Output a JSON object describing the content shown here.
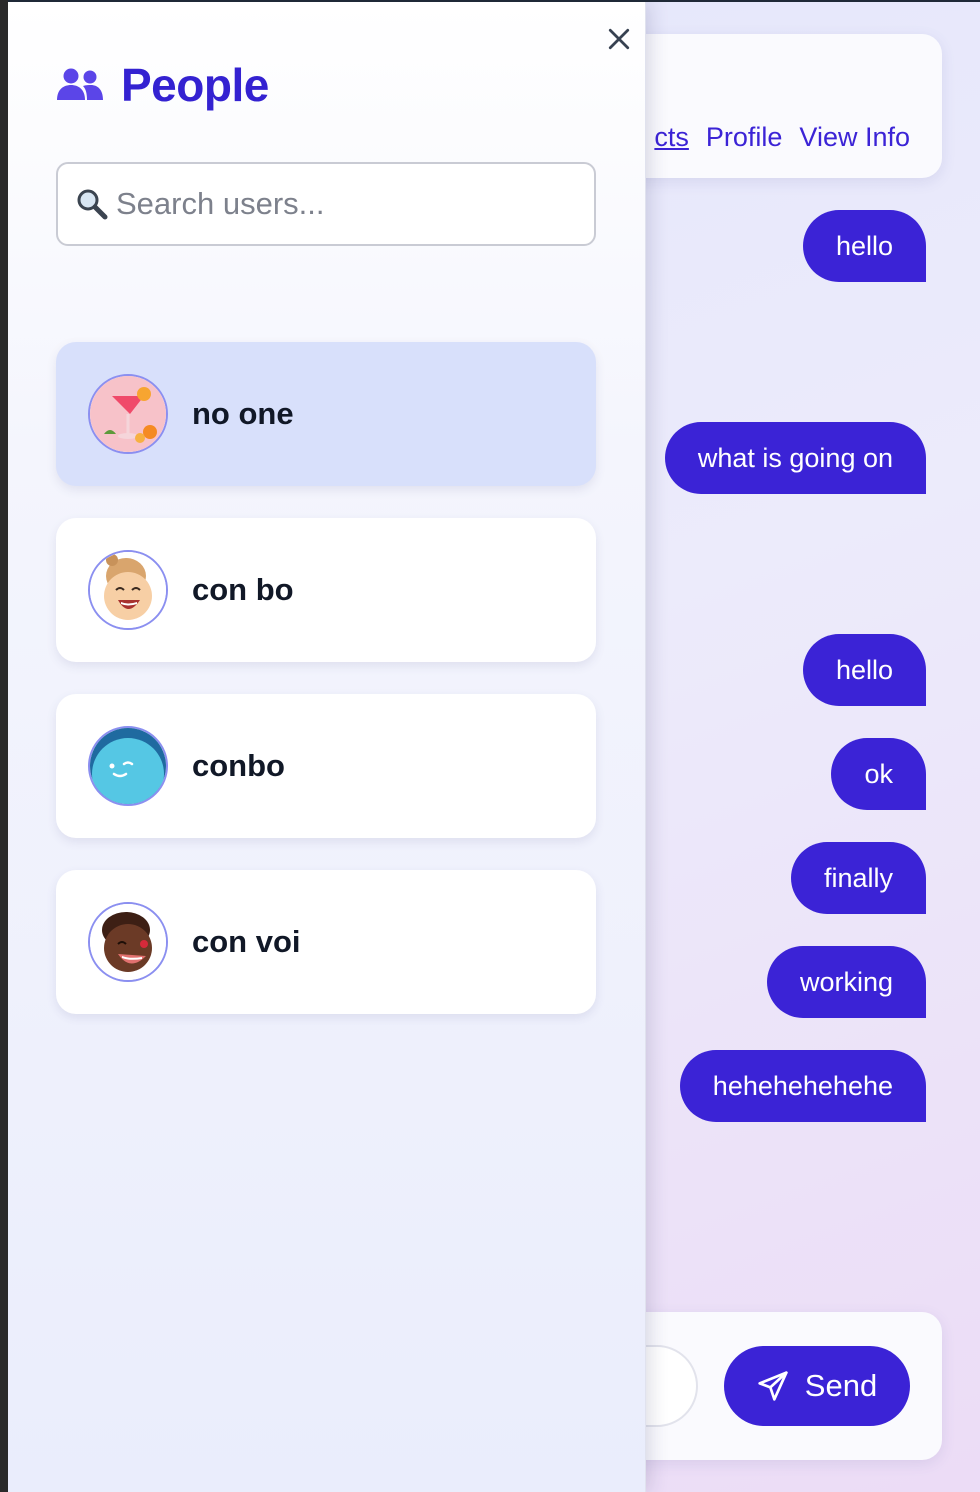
{
  "chat_header": {
    "links": [
      {
        "label": "Contacts",
        "visible_fragment": "cts"
      },
      {
        "label": "Profile"
      },
      {
        "label": "View Info"
      }
    ]
  },
  "messages": [
    {
      "text": "hello"
    },
    {
      "text": "what is going on"
    },
    {
      "text": "hello"
    },
    {
      "text": "ok"
    },
    {
      "text": "finally"
    },
    {
      "text": "working"
    },
    {
      "text": "hehehehehehe"
    }
  ],
  "composer": {
    "send_label": "Send",
    "send_icon": "paper-plane-icon"
  },
  "drawer": {
    "title": "People",
    "title_icon": "users-icon",
    "close_icon": "close-icon",
    "search": {
      "placeholder": "Search users...",
      "value": "",
      "icon": "magnifier-icon"
    },
    "users": [
      {
        "name": "no one",
        "avatar": "cocktail-avatar",
        "active": true
      },
      {
        "name": "con bo",
        "avatar": "laughing-blonde-avatar",
        "active": false
      },
      {
        "name": "conbo",
        "avatar": "blue-winking-avatar",
        "active": false
      },
      {
        "name": "con voi",
        "avatar": "laughing-dark-avatar",
        "active": false
      }
    ]
  },
  "colors": {
    "accent": "#3b23d6",
    "title": "#3422d1",
    "active_card": "#d8e0fb",
    "avatar_border": "#8b8ff0"
  }
}
